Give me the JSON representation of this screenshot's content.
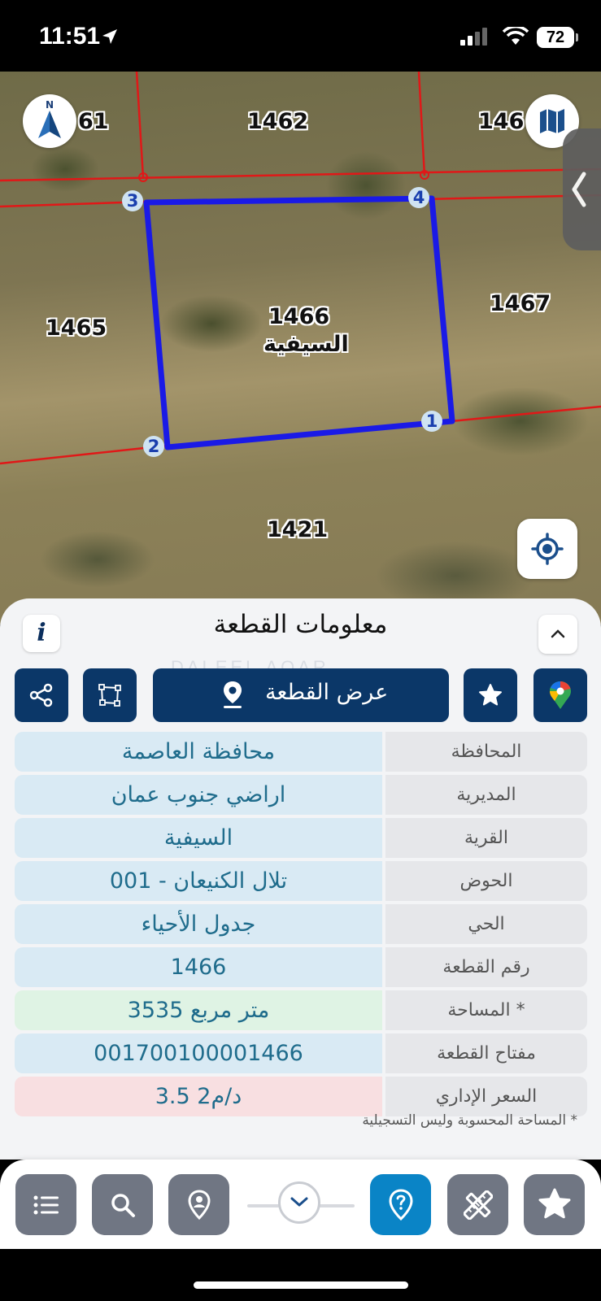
{
  "status_bar": {
    "time": "11:51",
    "battery": "72"
  },
  "map": {
    "compass_letter": "N",
    "parcels": {
      "p_1461": "61",
      "p_1462": "1462",
      "p_1463": "146",
      "p_1465": "1465",
      "p_1466_num": "1466",
      "p_1466_name": "السيفية",
      "p_1467": "1467",
      "p_1421": "1421"
    },
    "vertices": {
      "v1": "1",
      "v2": "2",
      "v3": "3",
      "v4": "4"
    },
    "boundary_color": "#1a1ae6",
    "grid_color": "#e01818"
  },
  "sheet": {
    "info_label": "i",
    "title": "معلومات القطعة",
    "watermark": "DALEEL AQAR",
    "show_button": "عرض القطعة",
    "rows": [
      {
        "label": "المحافظة",
        "value": "محافظة العاصمة",
        "tone": "#d9eaf4"
      },
      {
        "label": "المديرية",
        "value": "اراضي جنوب عمان",
        "tone": "#d9eaf4"
      },
      {
        "label": "القرية",
        "value": "السيفية",
        "tone": "#d9eaf4"
      },
      {
        "label": "الحوض",
        "value": "تلال الكنيعان - 001",
        "tone": "#d9eaf4"
      },
      {
        "label": "الحي",
        "value": "جدول الأحياء",
        "tone": "#d9eaf4"
      },
      {
        "label": "رقم القطعة",
        "value": "1466",
        "tone": "#d9eaf4"
      },
      {
        "label": "المساحة *",
        "value": "3535  متر مربع",
        "tone": "#dff3e4"
      },
      {
        "label": "مفتاح القطعة",
        "value": "001700100001466",
        "tone": "#d9eaf4"
      },
      {
        "label": "السعر الإداري",
        "value": "3.5 د/م2",
        "tone": "#f8dfe1"
      }
    ],
    "footnote": "* المساحة المحسوبة وليس التسجيلية"
  },
  "tab_bar": {
    "icons": [
      "list-icon",
      "search-icon",
      "user-pin-icon",
      "help-pin-icon",
      "measure-icon",
      "star-icon"
    ],
    "accent": "#0a84c6"
  }
}
